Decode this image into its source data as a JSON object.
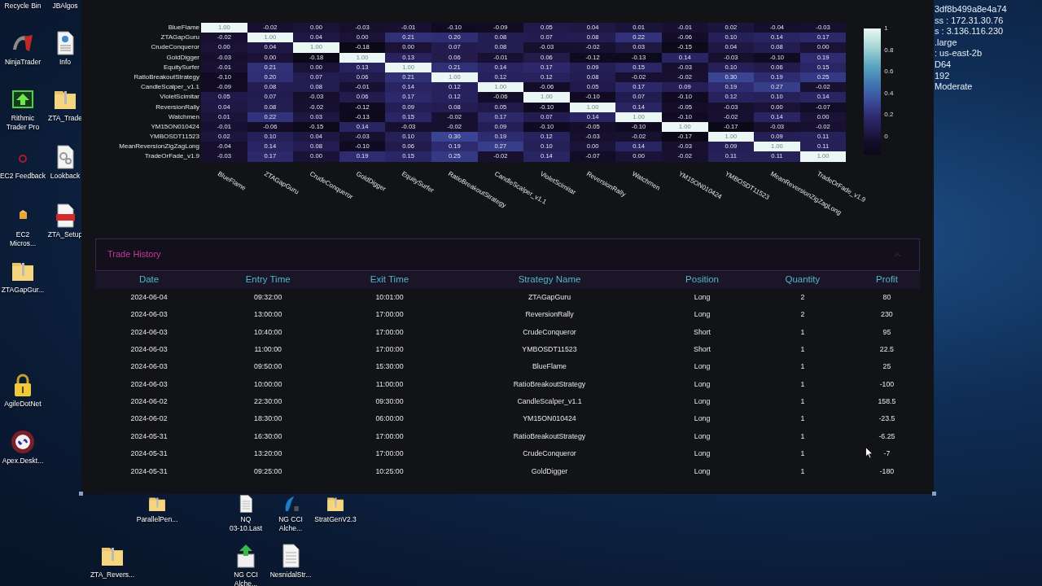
{
  "desktop_icons": [
    {
      "label": "Recycle Bin",
      "kind": "offscreen"
    },
    {
      "label": "JBAlgos",
      "kind": "offscreen"
    },
    {
      "label": "NinjaTrader",
      "kind": "swoosh"
    },
    {
      "label": "Info",
      "kind": "web-document"
    },
    {
      "label": "Rithmic\nTrader Pro",
      "kind": "arrow-screen"
    },
    {
      "label": "ZTA_Trade",
      "kind": "zip-folder"
    },
    {
      "label": "EC2 Feedback",
      "kind": "ring"
    },
    {
      "label": "Lookback",
      "kind": "gear-document"
    },
    {
      "label": "EC2\nMicros...",
      "kind": "package"
    },
    {
      "label": "ZTA_Setup",
      "kind": "pdf"
    },
    {
      "label": "ZTAGapGur...",
      "kind": "zip-folder"
    },
    {
      "label": "AgileDotNet",
      "kind": "lock"
    },
    {
      "label": "Apex.Deskt...",
      "kind": "round-badge"
    },
    {
      "label": "ParallelPen...",
      "kind": "zip-folder"
    },
    {
      "label": "NQ\n03-10.Last",
      "kind": "document"
    },
    {
      "label": "NG CCI\nAlche...",
      "kind": "blue-leaf"
    },
    {
      "label": "StratGenV2.3",
      "kind": "zip-folder"
    },
    {
      "label": "ZTA_Revers...",
      "kind": "zip-folder"
    },
    {
      "label": "NG CCI\nAlche...",
      "kind": "box-arrow"
    },
    {
      "label": "NesnidalStr...",
      "kind": "document"
    }
  ],
  "instance_info": [
    "3df8b499a8e4a74",
    "ss : 172.31.30.76",
    "s : 3.136.116.230",
    ".large",
    ": us-east-2b",
    "D64",
    "192",
    "Moderate"
  ],
  "heatmap": {
    "columns": [
      "BlueFlame",
      "ZTAGapGuru",
      "CrudeConqueror",
      "GoldDigger",
      "EquitySurfer",
      "RatioBreakoutStrategy",
      "CandleScalper_v1.1",
      "VioletScimitar",
      "ReversionRally",
      "Watchmen",
      "YM15ON010424",
      "YMBOSDT11523",
      "MeanReversionZigZagLong",
      "TradeOrFade_v1.9"
    ],
    "rows": [
      {
        "label": "BlueFlame",
        "values": [
          "1.00",
          "-0.02",
          "0.00",
          "-0.03",
          "-0.01",
          "-0.10",
          "-0.09",
          "0.05",
          "0.04",
          "0.01",
          "-0.01",
          "0.02",
          "-0.04",
          "-0.03"
        ]
      },
      {
        "label": "ZTAGapGuru",
        "values": [
          "-0.02",
          "1.00",
          "0.04",
          "0.00",
          "0.21",
          "0.20",
          "0.08",
          "0.07",
          "0.08",
          "0.22",
          "-0.06",
          "0.10",
          "0.14",
          "0.17"
        ]
      },
      {
        "label": "CrudeConqueror",
        "values": [
          "0.00",
          "0.04",
          "1.00",
          "-0.18",
          "0.00",
          "0.07",
          "0.08",
          "-0.03",
          "-0.02",
          "0.03",
          "-0.15",
          "0.04",
          "0.08",
          "0.00"
        ]
      },
      {
        "label": "GoldDigger",
        "values": [
          "-0.03",
          "0.00",
          "-0.18",
          "1.00",
          "0.13",
          "0.06",
          "-0.01",
          "0.06",
          "-0.12",
          "-0.13",
          "0.14",
          "-0.03",
          "-0.10",
          "0.19"
        ]
      },
      {
        "label": "EquitySurfer",
        "values": [
          "-0.01",
          "0.21",
          "0.00",
          "0.13",
          "1.00",
          "0.21",
          "0.14",
          "0.17",
          "0.09",
          "0.15",
          "-0.03",
          "0.10",
          "0.06",
          "0.15"
        ]
      },
      {
        "label": "RatioBreakoutStrategy",
        "values": [
          "-0.10",
          "0.20",
          "0.07",
          "0.06",
          "0.21",
          "1.00",
          "0.12",
          "0.12",
          "0.08",
          "-0.02",
          "-0.02",
          "0.30",
          "0.19",
          "0.25"
        ]
      },
      {
        "label": "CandleScalper_v1.1",
        "values": [
          "-0.09",
          "0.08",
          "0.08",
          "-0.01",
          "0.14",
          "0.12",
          "1.00",
          "-0.06",
          "0.05",
          "0.17",
          "0.09",
          "0.19",
          "0.27",
          "-0.02"
        ]
      },
      {
        "label": "VioletScimitar",
        "values": [
          "0.05",
          "0.07",
          "-0.03",
          "0.06",
          "0.17",
          "0.12",
          "-0.06",
          "1.00",
          "-0.10",
          "0.07",
          "-0.10",
          "0.12",
          "0.10",
          "0.14"
        ]
      },
      {
        "label": "ReversionRally",
        "values": [
          "0.04",
          "0.08",
          "-0.02",
          "-0.12",
          "0.09",
          "0.08",
          "0.05",
          "-0.10",
          "1.00",
          "0.14",
          "-0.05",
          "-0.03",
          "0.00",
          "-0.07"
        ]
      },
      {
        "label": "Watchmen",
        "values": [
          "0.01",
          "0.22",
          "0.03",
          "-0.13",
          "0.15",
          "-0.02",
          "0.17",
          "0.07",
          "0.14",
          "1.00",
          "-0.10",
          "-0.02",
          "0.14",
          "0.00"
        ]
      },
      {
        "label": "YM15ON010424",
        "values": [
          "-0.01",
          "-0.06",
          "-0.15",
          "0.14",
          "-0.03",
          "-0.02",
          "0.09",
          "-0.10",
          "-0.05",
          "-0.10",
          "1.00",
          "-0.17",
          "-0.03",
          "-0.02"
        ]
      },
      {
        "label": "YMBOSDT11523",
        "values": [
          "0.02",
          "0.10",
          "0.04",
          "-0.03",
          "0.10",
          "0.30",
          "0.19",
          "0.12",
          "-0.03",
          "-0.02",
          "-0.17",
          "1.00",
          "0.09",
          "0.11"
        ]
      },
      {
        "label": "MeanReversionZigZagLong",
        "values": [
          "-0.04",
          "0.14",
          "0.08",
          "-0.10",
          "0.06",
          "0.19",
          "0.27",
          "0.10",
          "0.00",
          "0.14",
          "-0.03",
          "0.09",
          "1.00",
          "0.11"
        ]
      },
      {
        "label": "TradeOrFade_v1.9",
        "values": [
          "-0.03",
          "0.17",
          "0.00",
          "0.19",
          "0.15",
          "0.25",
          "-0.02",
          "0.14",
          "-0.07",
          "0.00",
          "-0.02",
          "0.11",
          "0.11",
          "1.00"
        ]
      }
    ],
    "colorbar_ticks": [
      "1",
      "0.8",
      "0.6",
      "0.4",
      "0.2",
      "0"
    ]
  },
  "trade_history": {
    "title": "Trade History",
    "columns": [
      "Date",
      "Entry Time",
      "Exit Time",
      "Strategy Name",
      "Position",
      "Quantity",
      "Profit"
    ],
    "rows": [
      [
        "2024-06-04",
        "09:32:00",
        "10:01:00",
        "ZTAGapGuru",
        "Long",
        "2",
        "80"
      ],
      [
        "2024-06-03",
        "13:00:00",
        "17:00:00",
        "ReversionRally",
        "Long",
        "2",
        "230"
      ],
      [
        "2024-06-03",
        "10:40:00",
        "17:00:00",
        "CrudeConqueror",
        "Short",
        "1",
        "95"
      ],
      [
        "2024-06-03",
        "11:00:00",
        "17:00:00",
        "YMBOSDT11523",
        "Short",
        "1",
        "22.5"
      ],
      [
        "2024-06-03",
        "09:50:00",
        "15:30:00",
        "BlueFlame",
        "Long",
        "1",
        "25"
      ],
      [
        "2024-06-03",
        "10:00:00",
        "11:00:00",
        "RatioBreakoutStrategy",
        "Long",
        "1",
        "-100"
      ],
      [
        "2024-06-02",
        "22:30:00",
        "09:30:00",
        "CandleScalper_v1.1",
        "Long",
        "1",
        "158.5"
      ],
      [
        "2024-06-02",
        "18:30:00",
        "06:00:00",
        "YM15ON010424",
        "Long",
        "1",
        "-23.5"
      ],
      [
        "2024-05-31",
        "16:30:00",
        "17:00:00",
        "RatioBreakoutStrategy",
        "Long",
        "1",
        "-6.25"
      ],
      [
        "2024-05-31",
        "13:20:00",
        "17:00:00",
        "CrudeConqueror",
        "Long",
        "1",
        "-7"
      ],
      [
        "2024-05-31",
        "09:25:00",
        "10:25:00",
        "GoldDigger",
        "Long",
        "1",
        "-180"
      ]
    ]
  }
}
